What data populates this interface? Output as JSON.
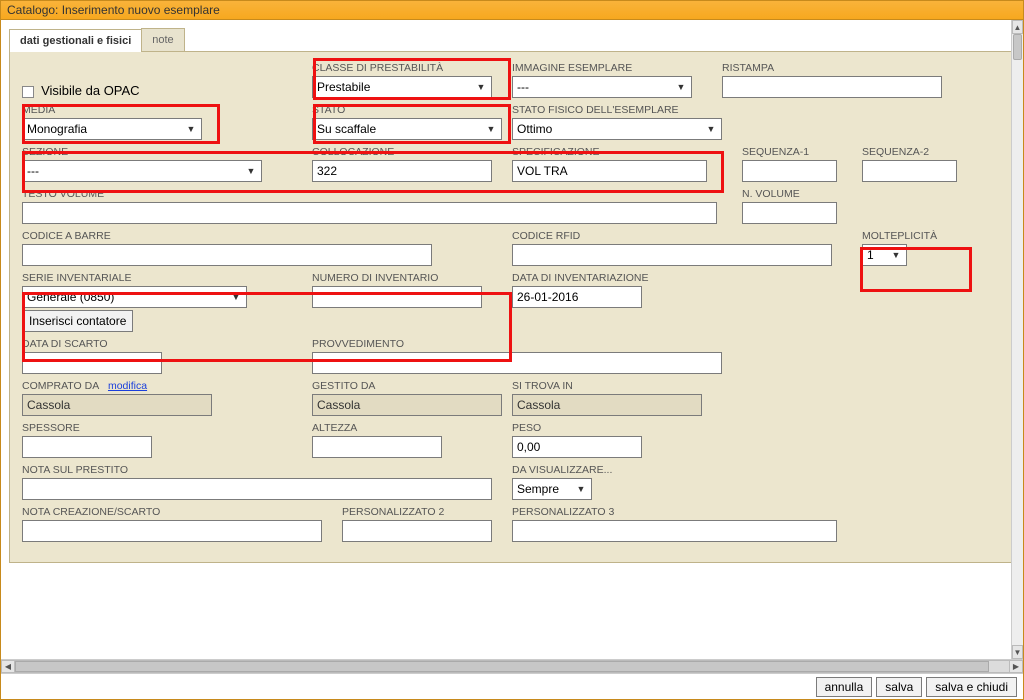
{
  "window": {
    "title": "Catalogo: Inserimento nuovo esemplare"
  },
  "tabs": {
    "t1": "dati gestionali e fisici",
    "t2": "note"
  },
  "form": {
    "visibile_opac_label": "Visibile da OPAC",
    "classe_prest_label": "CLASSE DI PRESTABILITÀ",
    "classe_prest_value": "Prestabile",
    "immagine_label": "IMMAGINE ESEMPLARE",
    "immagine_value": "---",
    "ristampa_label": "RISTAMPA",
    "ristampa_value": "",
    "media_label": "MEDIA",
    "media_value": "Monografia",
    "stato_label": "STATO",
    "stato_value": "Su scaffale",
    "stato_fisico_label": "STATO FISICO DELL'ESEMPLARE",
    "stato_fisico_value": "Ottimo",
    "sezione_label": "SEZIONE",
    "sezione_value": "---",
    "collocazione_label": "COLLOCAZIONE",
    "collocazione_value": "322",
    "specificazione_label": "SPECIFICAZIONE",
    "specificazione_value": "VOL TRA",
    "sequenza1_label": "SEQUENZA-1",
    "sequenza1_value": "",
    "sequenza2_label": "SEQUENZA-2",
    "sequenza2_value": "",
    "testo_volume_label": "TESTO VOLUME",
    "testo_volume_value": "",
    "n_volume_label": "N. VOLUME",
    "n_volume_value": "",
    "codice_barre_label": "CODICE A BARRE",
    "codice_barre_value": "",
    "codice_rfid_label": "CODICE RFID",
    "codice_rfid_value": "",
    "molteplicita_label": "MOLTEPLICITÀ",
    "molteplicita_value": "1",
    "serie_inv_label": "SERIE INVENTARIALE",
    "serie_inv_value": "Generale (0850)",
    "inserisci_contatore": "Inserisci contatore",
    "num_inv_label": "NUMERO DI INVENTARIO",
    "num_inv_value": "",
    "data_inv_label": "DATA DI INVENTARIAZIONE",
    "data_inv_value": "26-01-2016",
    "data_scarto_label": "DATA DI SCARTO",
    "data_scarto_value": "",
    "provvedimento_label": "PROVVEDIMENTO",
    "provvedimento_value": "",
    "comprato_da_label": "COMPRATO DA",
    "modifica_link": "modifica",
    "comprato_da_value": "Cassola",
    "gestito_da_label": "GESTITO DA",
    "gestito_da_value": "Cassola",
    "si_trova_in_label": "SI TROVA IN",
    "si_trova_in_value": "Cassola",
    "spessore_label": "SPESSORE",
    "spessore_value": "",
    "altezza_label": "ALTEZZA",
    "altezza_value": "",
    "peso_label": "PESO",
    "peso_value": "0,00",
    "nota_prestito_label": "NOTA SUL PRESTITO",
    "nota_prestito_value": "",
    "da_visualizzare_label": "DA VISUALIZZARE...",
    "da_visualizzare_value": "Sempre",
    "nota_creaz_label": "NOTA CREAZIONE/SCARTO",
    "nota_creaz_value": "",
    "pers2_label": "PERSONALIZZATO 2",
    "pers2_value": "",
    "pers3_label": "PERSONALIZZATO 3",
    "pers3_value": ""
  },
  "footer": {
    "annulla": "annulla",
    "salva": "salva",
    "salva_chiudi": "salva e chiudi"
  }
}
